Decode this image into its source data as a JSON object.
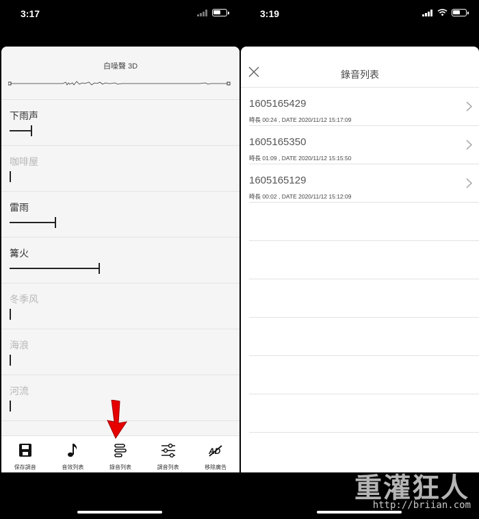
{
  "left_phone": {
    "status_time": "3:17",
    "mix_title": "白噪聲 3D",
    "sounds": [
      {
        "name": "下雨声",
        "level": 0.1,
        "active": true
      },
      {
        "name": "咖啡屋",
        "level": 0.0,
        "active": false
      },
      {
        "name": "雷雨",
        "level": 0.21,
        "active": true
      },
      {
        "name": "篝火",
        "level": 0.41,
        "active": true
      },
      {
        "name": "冬季风",
        "level": 0.0,
        "active": false
      },
      {
        "name": "海浪",
        "level": 0.0,
        "active": false
      },
      {
        "name": "河流",
        "level": 0.0,
        "active": false
      }
    ],
    "tabs": [
      {
        "label": "保存調音",
        "icon": "save-icon"
      },
      {
        "label": "音效列表",
        "icon": "music-note-icon"
      },
      {
        "label": "錄音列表",
        "icon": "recording-list-icon"
      },
      {
        "label": "調音列表",
        "icon": "sliders-icon"
      },
      {
        "label": "移除廣告",
        "icon": "remove-ads-icon"
      }
    ],
    "highlight_color": "#e60000"
  },
  "right_phone": {
    "status_time": "3:19",
    "title": "錄音列表",
    "recordings": [
      {
        "id": "1605165429",
        "meta": "時長 00:24 , DATE 2020/11/12 15:17:09"
      },
      {
        "id": "1605165350",
        "meta": "時長 01:09 , DATE 2020/11/12 15:15:50"
      },
      {
        "id": "1605165129",
        "meta": "時長 00:02 , DATE 2020/11/12 15:12:09"
      }
    ]
  },
  "watermark": {
    "text": "重灌狂人",
    "url": "http://briian.com"
  }
}
